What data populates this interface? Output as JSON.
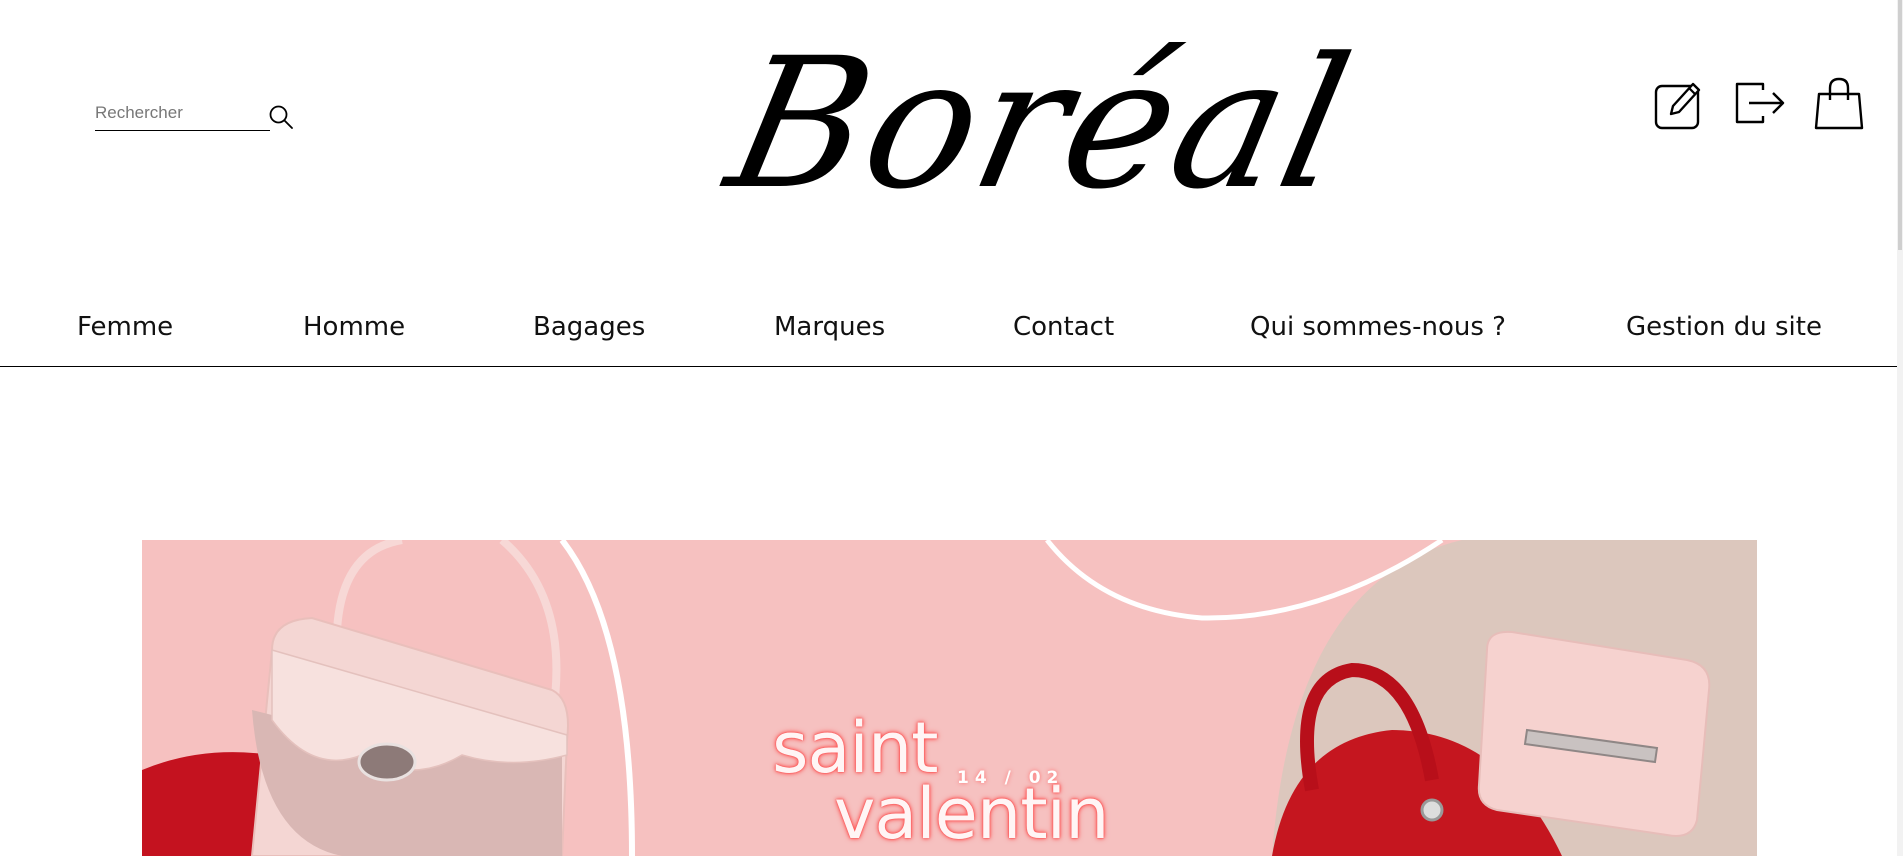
{
  "brand": {
    "logo_text": "Boréal"
  },
  "search": {
    "placeholder": "Rechercher",
    "icon": "search-icon"
  },
  "top_icons": [
    "edit-icon",
    "logout-icon",
    "shopping-bag-icon"
  ],
  "nav": {
    "items": [
      {
        "label": "Femme"
      },
      {
        "label": "Homme"
      },
      {
        "label": "Bagages"
      },
      {
        "label": "Marques"
      },
      {
        "label": "Contact"
      },
      {
        "label": "Qui sommes-nous ?"
      },
      {
        "label": "Gestion du site"
      }
    ]
  },
  "hero": {
    "title_line1": "saint",
    "title_line2": "valentin",
    "date": "14 / 02",
    "colors": {
      "background": "#f6c1c0",
      "neon": "#ff4b4b",
      "bag_red": "#c4121f",
      "beige": "#dcc7bd"
    }
  }
}
